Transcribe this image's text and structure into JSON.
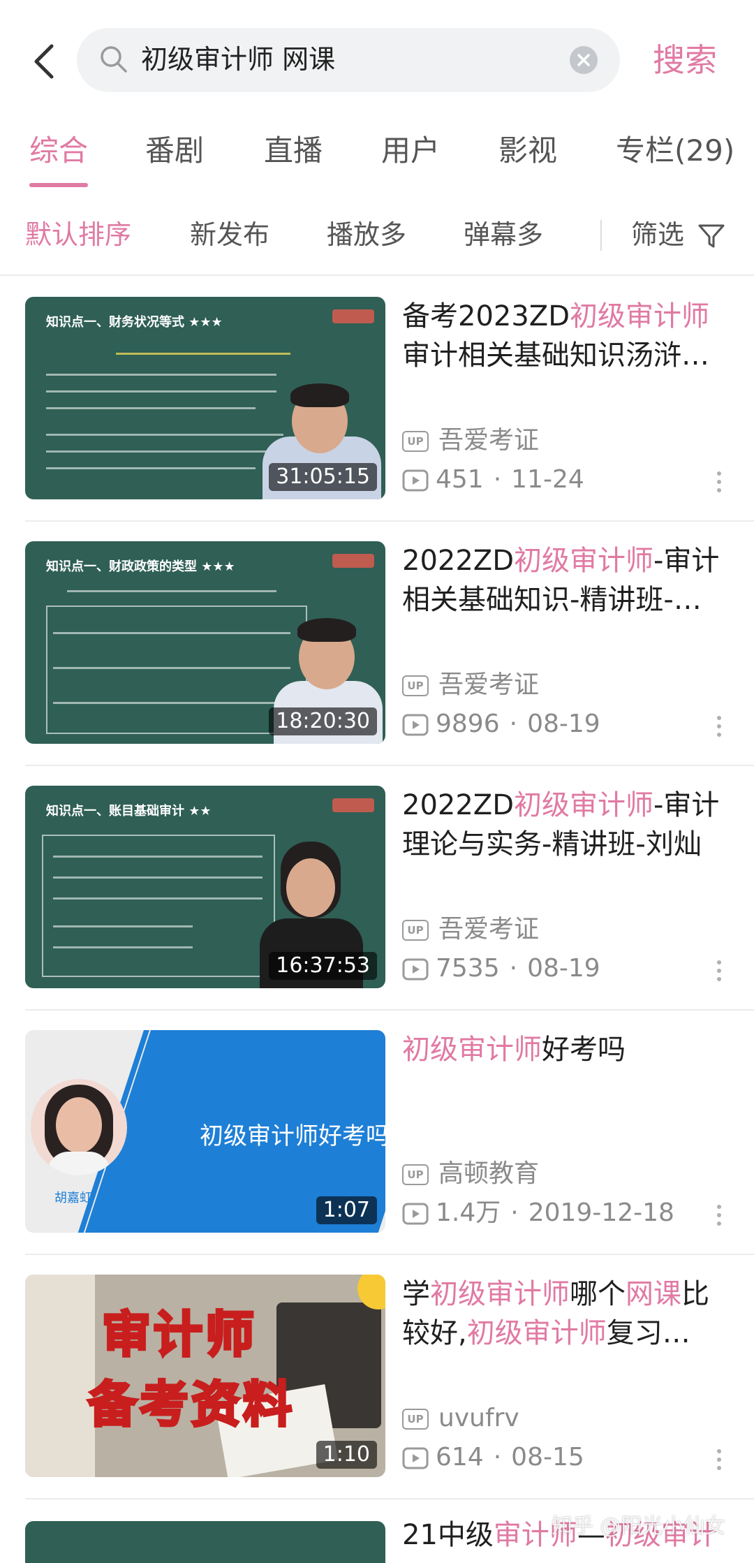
{
  "search": {
    "query": "初级审计师 网课",
    "submit_label": "搜索"
  },
  "tabs": [
    "综合",
    "番剧",
    "直播",
    "用户",
    "影视",
    "专栏(29)"
  ],
  "active_tab": 0,
  "sorts": [
    "默认排序",
    "新发布",
    "播放多",
    "弹幕多"
  ],
  "filter_label": "筛选",
  "accent_color": "#e07aa3",
  "results": [
    {
      "title_line1": [
        {
          "t": "备考2023ZD",
          "hl": false
        },
        {
          "t": "初级审计师",
          "hl": true
        }
      ],
      "title_line2": [
        {
          "t": "审计相关基础知识汤浒…",
          "hl": false
        }
      ],
      "duration": "31:05:15",
      "uploader": "吾爱考证",
      "plays": "451",
      "date": "11-24",
      "thumb_heading": "知识点一、财务状况等式 ★★★"
    },
    {
      "title_line1": [
        {
          "t": "2022ZD",
          "hl": false
        },
        {
          "t": "初级审计师",
          "hl": true
        },
        {
          "t": "-审计",
          "hl": false
        }
      ],
      "title_line2": [
        {
          "t": "相关基础知识-精讲班-…",
          "hl": false
        }
      ],
      "duration": "18:20:30",
      "uploader": "吾爱考证",
      "plays": "9896",
      "date": "08-19",
      "thumb_heading": "知识点一、财政政策的类型 ★★★"
    },
    {
      "title_line1": [
        {
          "t": "2022ZD",
          "hl": false
        },
        {
          "t": "初级审计师",
          "hl": true
        },
        {
          "t": "-审计",
          "hl": false
        }
      ],
      "title_line2": [
        {
          "t": "理论与实务-精讲班-刘灿",
          "hl": false
        }
      ],
      "duration": "16:37:53",
      "uploader": "吾爱考证",
      "plays": "7535",
      "date": "08-19",
      "thumb_heading": "知识点一、账目基础审计 ★★"
    },
    {
      "title_line1": [
        {
          "t": "初级审计师",
          "hl": true
        },
        {
          "t": "好考吗",
          "hl": false
        }
      ],
      "title_line2": [],
      "duration": "1:07",
      "uploader": "高顿教育",
      "plays": "1.4万",
      "date": "2019-12-18",
      "thumb_caption": "初级审计师好考吗",
      "thumb_name": "胡嘉虹"
    },
    {
      "title_line1": [
        {
          "t": "学",
          "hl": false
        },
        {
          "t": "初级审计师",
          "hl": true
        },
        {
          "t": "哪个",
          "hl": false
        },
        {
          "t": "网课",
          "hl": true
        },
        {
          "t": "比",
          "hl": false
        }
      ],
      "title_line2": [
        {
          "t": "较好,",
          "hl": false
        },
        {
          "t": "初级审计师",
          "hl": true
        },
        {
          "t": "复习…",
          "hl": false
        }
      ],
      "duration": "1:10",
      "uploader": "uvufrv",
      "plays": "614",
      "date": "08-15",
      "thumb_text1": "审计师",
      "thumb_text2": "备考资料"
    }
  ],
  "partial_result": {
    "title_line1": [
      {
        "t": "21中级",
        "hl": false
      },
      {
        "t": "审计师",
        "hl": true
      },
      {
        "t": "—",
        "hl": false
      },
      {
        "t": "初级审计",
        "hl": true
      }
    ]
  },
  "watermark": "知乎 @阳光小仙女",
  "up_badge": "UP"
}
